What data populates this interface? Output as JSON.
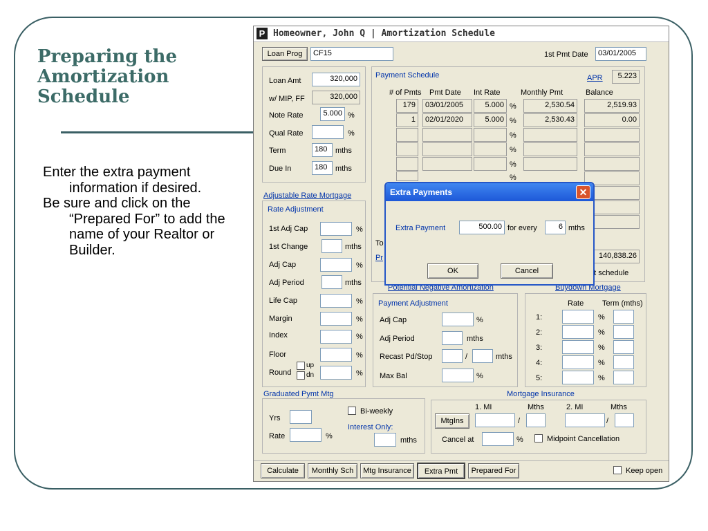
{
  "slide": {
    "title": [
      "Preparing the",
      "Amortization",
      "Schedule"
    ],
    "bullets": [
      "Enter the extra payment information if desired.",
      "Be sure and click on the “Prepared For” to add the name of your Realtor or Builder."
    ]
  },
  "app": {
    "title_icon": "P",
    "title": "Homeowner, John Q | Amortization Schedule",
    "loan_prog_button": "Loan Prog",
    "loan_prog_value": "CF15",
    "first_pmt_label": "1st Pmt Date",
    "first_pmt_value": "03/01/2005",
    "loan": {
      "loan_amt_label": "Loan Amt",
      "loan_amt_value": "320,000",
      "mip_label": "w/ MIP, FF",
      "mip_value": "320,000",
      "note_rate_label": "Note Rate",
      "note_rate_value": "5.000",
      "note_rate_unit": "%",
      "qual_rate_label": "Qual Rate",
      "qual_rate_unit": "%",
      "term_label": "Term",
      "term_value": "180",
      "term_unit": "mths",
      "due_in_label": "Due In",
      "due_in_value": "180",
      "due_in_unit": "mths"
    },
    "schedule": {
      "title": "Payment Schedule",
      "apr_label": "APR",
      "apr_value": "5.223",
      "headers": [
        "# of Pmts",
        "Pmt Date",
        "Int Rate",
        "Monthly Pmt",
        "Balance"
      ],
      "rows": [
        {
          "pmts": "179",
          "date": "03/01/2005",
          "rate": "5.000",
          "pmt": "2,530.54",
          "bal": "2,519.93"
        },
        {
          "pmts": "1",
          "date": "02/01/2020",
          "rate": "5.000",
          "pmt": "2,530.43",
          "bal": "0.00"
        }
      ],
      "pct": "%",
      "total_label_partial": "To",
      "pr_link_partial": "Pr",
      "total_value": "140,838.26",
      "sched_label_partial": "nt schedule"
    },
    "arm": {
      "title": "Adjustable Rate Mortgage",
      "rate_adj_title": "Rate Adjustment",
      "labels": [
        "1st Adj Cap",
        "1st Change",
        "Adj Cap",
        "Adj Period",
        "Life Cap",
        "Margin",
        "Index",
        "Floor"
      ],
      "units": [
        "%",
        "mths",
        "%",
        "mths",
        "%",
        "%",
        "%",
        "%"
      ],
      "round_label": "Round",
      "round_up": "up",
      "round_dn": "dn",
      "round_unit": "%"
    },
    "neg_am_link": "Potential Negative Amortization",
    "buydown_link": "Buydown Mortgage",
    "payment_adj": {
      "title": "Payment Adjustment",
      "adj_cap": "Adj Cap",
      "adj_cap_unit": "%",
      "adj_period": "Adj Period",
      "adj_period_unit": "mths",
      "recast": "Recast Pd/Stop",
      "recast_sep": "/",
      "recast_unit": "mths",
      "max_bal": "Max Bal",
      "max_bal_unit": "%"
    },
    "buydown": {
      "rate_header": "Rate",
      "term_header": "Term (mths)",
      "rows": [
        "1:",
        "2:",
        "3:",
        "4:",
        "5:"
      ],
      "pct": "%"
    },
    "gpm": {
      "title": "Graduated Pymt Mtg",
      "yrs_label": "Yrs",
      "rate_label": "Rate",
      "rate_unit": "%",
      "biweekly_label": "Bi-weekly",
      "interest_only_label": "Interest Only:",
      "interest_only_unit": "mths"
    },
    "mi": {
      "title": "Mortgage Insurance",
      "mi1_header": "1. MI",
      "mths_header": "Mths",
      "mi2_header": "2. MI",
      "mths2_header": "Mths",
      "mtgins_button": "MtgIns",
      "sep": "/",
      "cancel_label": "Cancel at",
      "cancel_unit": "%",
      "midpoint_label": "Midpoint Cancellation"
    },
    "bottom": {
      "calculate": "Calculate",
      "monthly_sch": "Monthly Sch",
      "mtg_insurance": "Mtg Insurance",
      "extra_pmt": "Extra Pmt",
      "prepared_for": "Prepared For",
      "keep_open": "Keep open"
    }
  },
  "dialog": {
    "title": "Extra Payments",
    "extra_label": "Extra Payment",
    "extra_value": "500.00",
    "for_every": "for every",
    "every_value": "6",
    "every_unit": "mths",
    "ok": "OK",
    "cancel": "Cancel"
  }
}
